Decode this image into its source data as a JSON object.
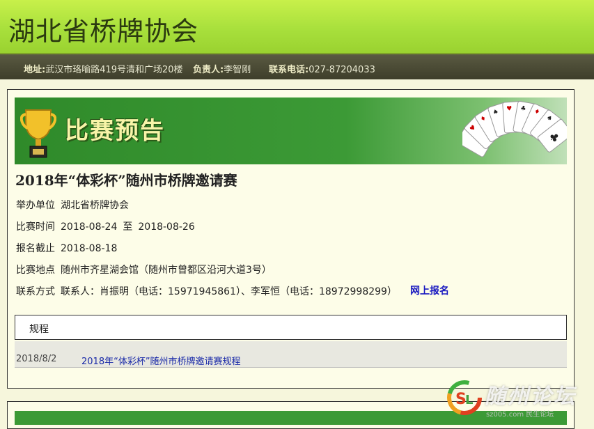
{
  "header": {
    "site_title": "湖北省桥牌协会"
  },
  "infobar": {
    "address_label": "地址:",
    "address": "武汉市珞喻路419号清和广场20楼",
    "contact_label": "负责人:",
    "contact": "李智刚",
    "phone_label": "联系电话:",
    "phone": "027-87204033"
  },
  "banner": {
    "title": "比赛预告"
  },
  "event": {
    "title": "2018年“体彩杯”随州市桥牌邀请赛",
    "organizer_label": "举办单位",
    "organizer": "湖北省桥牌协会",
    "time_label": "比赛时间",
    "start_date": "2018-08-24",
    "to": "至",
    "end_date": "2018-08-26",
    "deadline_label": "报名截止",
    "deadline": "2018-08-18",
    "venue_label": "比赛地点",
    "venue": "随州市齐星湖会馆（随州市曾都区沿河大道3号）",
    "contact_label": "联系方式",
    "contact_info": "联系人：肖振明（电话：15971945861）、李军恒（电话：18972998299）",
    "signup_link": "网上报名"
  },
  "tabs": {
    "rules_label": "规程"
  },
  "documents": [
    {
      "date": "2018/8/2",
      "title": "2018年“体彩杯”随州市桥牌邀请赛规程"
    }
  ],
  "watermark": {
    "text": "随州论坛",
    "sub": "sz005.com 民生论坛"
  },
  "colors": {
    "header_green": "#a8e03c",
    "banner_green": "#3c9a36",
    "link_blue": "#1a2aa8",
    "signup_blue": "#1818c0"
  }
}
